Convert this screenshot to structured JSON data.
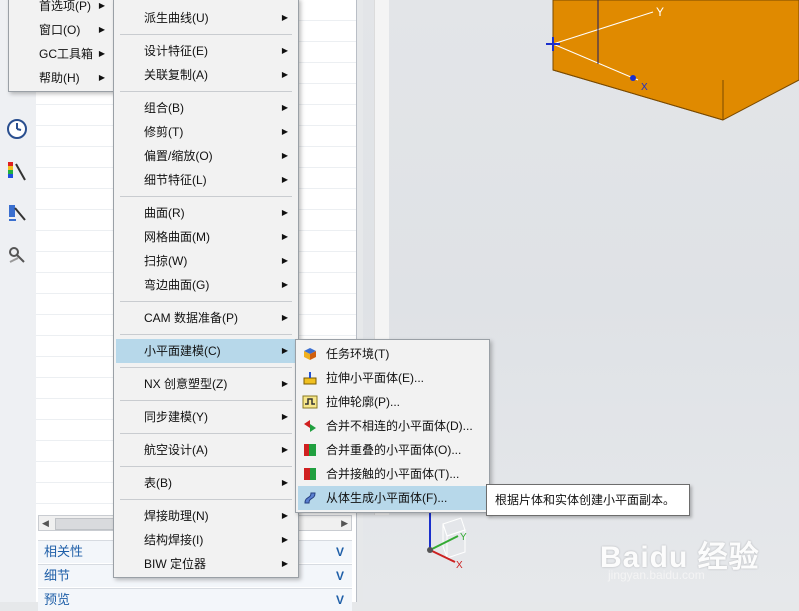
{
  "top_menu": {
    "items": [
      {
        "label": "首选项(P)",
        "arrow": "▶"
      },
      {
        "label": "窗口(O)",
        "arrow": "▶"
      },
      {
        "label": "GC工具箱",
        "arrow": "▶"
      },
      {
        "label": "帮助(H)",
        "arrow": "▶"
      }
    ]
  },
  "insert_menu": {
    "items": [
      {
        "label": "派生曲线(U)",
        "arrow": "▶"
      },
      {
        "label": "设计特征(E)",
        "arrow": "▶"
      },
      {
        "label": "关联复制(A)",
        "arrow": "▶"
      },
      {
        "label": "组合(B)",
        "arrow": "▶"
      },
      {
        "label": "修剪(T)",
        "arrow": "▶"
      },
      {
        "label": "偏置/缩放(O)",
        "arrow": "▶"
      },
      {
        "label": "细节特征(L)",
        "arrow": "▶"
      },
      {
        "label": "曲面(R)",
        "arrow": "▶"
      },
      {
        "label": "网格曲面(M)",
        "arrow": "▶"
      },
      {
        "label": "扫掠(W)",
        "arrow": "▶"
      },
      {
        "label": "弯边曲面(G)",
        "arrow": "▶"
      },
      {
        "label": "CAM 数据准备(P)",
        "arrow": "▶"
      },
      {
        "label": "小平面建模(C)",
        "arrow": "▶"
      },
      {
        "label": "NX 创意塑型(Z)",
        "arrow": "▶"
      },
      {
        "label": "同步建模(Y)",
        "arrow": "▶"
      },
      {
        "label": "航空设计(A)",
        "arrow": "▶"
      },
      {
        "label": "表(B)",
        "arrow": "▶"
      },
      {
        "label": "焊接助理(N)",
        "arrow": "▶"
      },
      {
        "label": "结构焊接(I)",
        "arrow": "▶"
      },
      {
        "label": "BIW 定位器",
        "arrow": "▶"
      }
    ]
  },
  "facet_menu": {
    "items": [
      {
        "label": "任务环境(T)",
        "icon": "task-environment-icon"
      },
      {
        "label": "拉伸小平面体(E)...",
        "icon": "extrude-facet-body-icon"
      },
      {
        "label": "拉伸轮廓(P)...",
        "icon": "extrude-profile-icon"
      },
      {
        "label": "合并不相连的小平面体(D)...",
        "icon": "merge-disjoint-icon"
      },
      {
        "label": "合并重叠的小平面体(O)...",
        "icon": "merge-overlapping-icon"
      },
      {
        "label": "合并接触的小平面体(T)...",
        "icon": "merge-touching-icon"
      },
      {
        "label": "从体生成小平面体(F)...",
        "icon": "facet-from-body-icon"
      }
    ]
  },
  "tooltip": {
    "text": "根据片体和实体创建小平面副本。"
  },
  "navigator": {
    "sections": [
      {
        "label": "相关性",
        "chevron": "V"
      },
      {
        "label": "细节",
        "chevron": "V"
      },
      {
        "label": "预览",
        "chevron": "V"
      }
    ],
    "scroll_left": "◀",
    "scroll_right": "▶"
  },
  "viewport": {
    "axis_labels": {
      "y": "Y",
      "x": "X",
      "small_y": "Y",
      "small_x": "X"
    },
    "block_color": "#e08a00"
  },
  "watermark": {
    "brand": "Baidu 经验",
    "url": "jingyan.baidu.com"
  },
  "colors": {
    "highlight": "#b7d8ea",
    "section_text": "#1f5fa8"
  }
}
